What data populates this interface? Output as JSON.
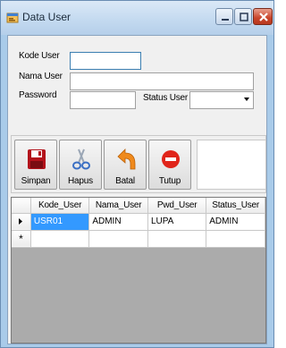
{
  "window": {
    "title": "Data User",
    "app_icon": "form-icon",
    "controls": [
      "minimize-icon",
      "maximize-icon",
      "close-icon"
    ],
    "close_color": "#c9442a"
  },
  "form": {
    "kode_user_label": "Kode User",
    "kode_user_value": "",
    "nama_user_label": "Nama User",
    "nama_user_value": "",
    "password_label": "Password",
    "password_value": "",
    "status_user_label": "Status User",
    "status_user_value": ""
  },
  "toolbar": {
    "buttons": [
      {
        "label": "Simpan",
        "icon": "floppy-disk-icon",
        "color": "#b3121b"
      },
      {
        "label": "Hapus",
        "icon": "scissors-icon",
        "color": "#3a6fc4"
      },
      {
        "label": "Batal",
        "icon": "undo-arrow-icon",
        "color": "#f08a1c"
      },
      {
        "label": "Tutup",
        "icon": "stop-icon",
        "color": "#e0241a"
      }
    ]
  },
  "grid": {
    "columns": [
      "Kode_User",
      "Nama_User",
      "Pwd_User",
      "Status_User"
    ],
    "rows": [
      {
        "marker": "current-row-icon",
        "cells": [
          "USR01",
          "ADMIN",
          "LUPA",
          "ADMIN"
        ]
      }
    ],
    "new_row_marker": "*",
    "selection_color": "#3399ff"
  }
}
